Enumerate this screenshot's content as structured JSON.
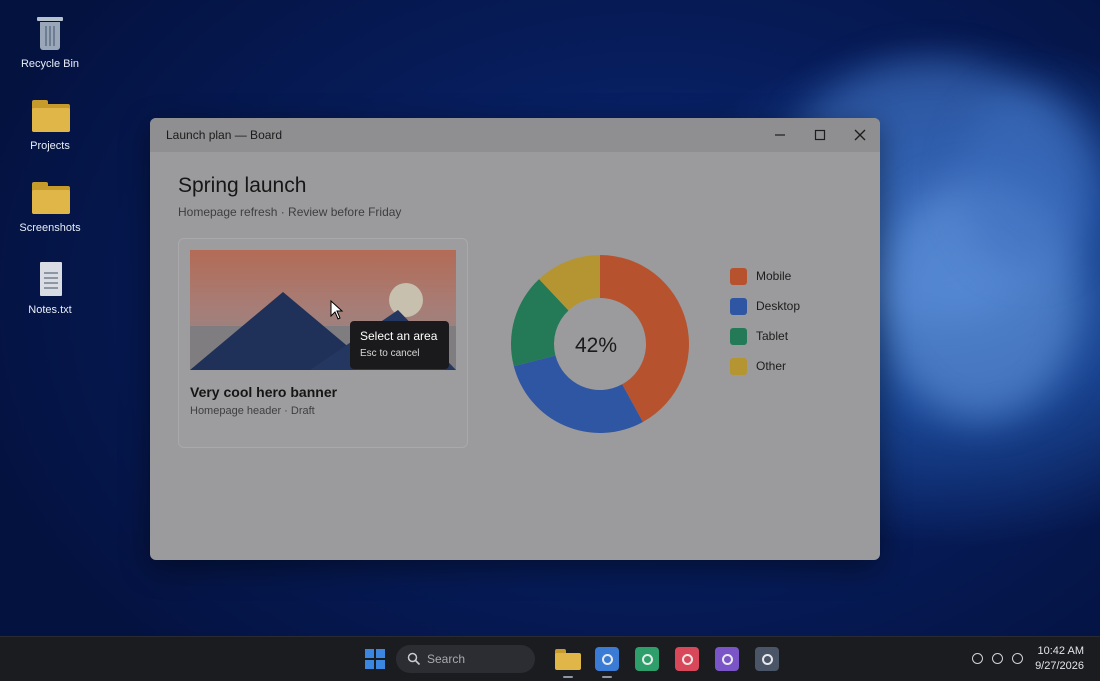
{
  "desktop": {
    "icons": [
      {
        "label": "Recycle Bin",
        "icon": "recycle-bin-icon"
      },
      {
        "label": "Projects",
        "icon": "folder-icon"
      },
      {
        "label": "Screenshots",
        "icon": "folder-icon"
      },
      {
        "label": "Notes.txt",
        "icon": "text-file-icon"
      }
    ]
  },
  "window": {
    "title": "Launch plan — Board",
    "controls": [
      "minimize-icon",
      "maximize-icon",
      "close-icon"
    ],
    "heading": "Spring launch",
    "subheading": "Homepage refresh · Review before Friday",
    "card": {
      "title": "Very cool hero banner",
      "subtitle": "Homepage header · Draft"
    },
    "tooltip": {
      "title": "Select an area",
      "hint": "Esc to cancel"
    }
  },
  "chart_data": {
    "type": "pie",
    "center_label": "42%",
    "categories": [
      "Mobile",
      "Desktop",
      "Tablet",
      "Other"
    ],
    "values": [
      42,
      29,
      17,
      12
    ],
    "colors": [
      "#b6532e",
      "#2f56a3",
      "#247a56",
      "#b59432"
    ],
    "legend_position": "right"
  },
  "taskbar": {
    "search_placeholder": "Search",
    "apps": [
      {
        "icon": "file-explorer-icon",
        "color": "#e0b648"
      },
      {
        "icon": "app-blue-icon",
        "color": "#3a7bd5"
      },
      {
        "icon": "app-green-icon",
        "color": "#2e9e6b"
      },
      {
        "icon": "app-red-icon",
        "color": "#d9485a"
      },
      {
        "icon": "app-purple-icon",
        "color": "#7a55c8"
      },
      {
        "icon": "app-slate-icon",
        "color": "#4a5568"
      }
    ],
    "clock_time": "10:42 AM",
    "clock_date": "9/27/2026"
  }
}
